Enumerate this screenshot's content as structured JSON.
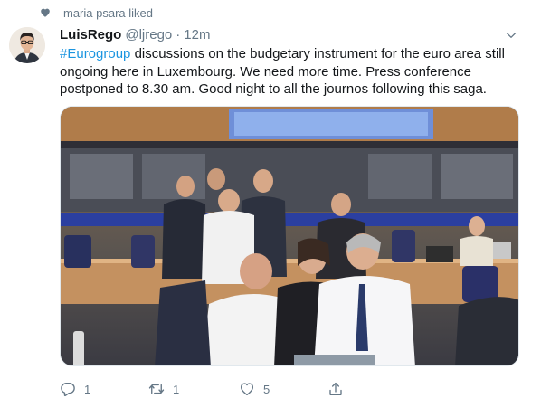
{
  "social_context": {
    "icon": "heart-icon",
    "text": "maria psara liked"
  },
  "tweet": {
    "author_name": "LuisRego",
    "handle": "@ljrego",
    "separator": "·",
    "time": "12m",
    "hashtag": "#Eurogroup",
    "body": " discussions on the budgetary instrument for the euro area  still ongoing here in Luxembourg. We need more time. Press conference postponed to 8.30 am. Good night to all the journos following this saga.",
    "media_description_icon": "photo",
    "actions": {
      "reply": {
        "icon": "reply-icon",
        "count": "1"
      },
      "retweet": {
        "icon": "retweet-icon",
        "count": "1"
      },
      "like": {
        "icon": "heart-outline-icon",
        "count": "5"
      },
      "share": {
        "icon": "share-icon"
      }
    }
  },
  "colors": {
    "link": "#1b95e0",
    "secondary_text": "#657786",
    "primary_text": "#14171a"
  }
}
